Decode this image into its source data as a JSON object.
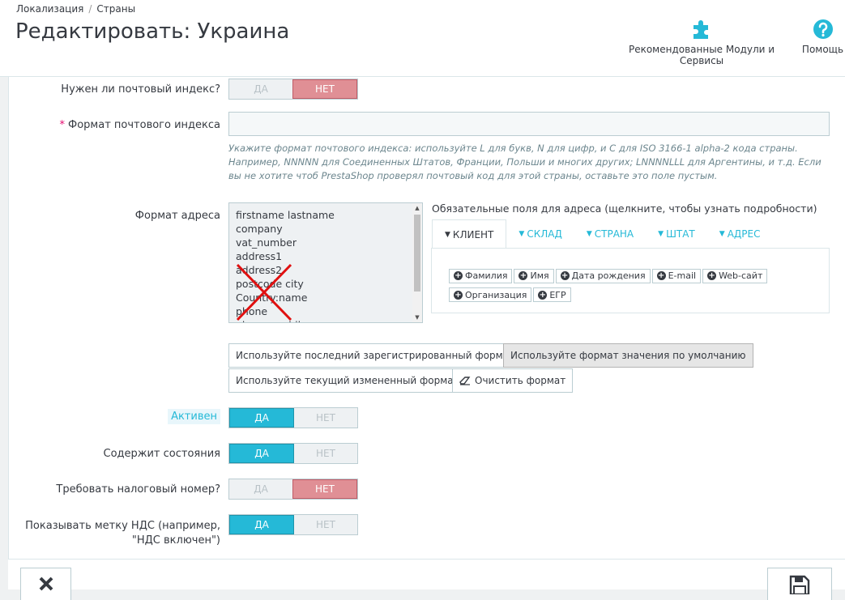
{
  "breadcrumb": {
    "items": [
      "Локализация",
      "Страны"
    ],
    "separator": "/"
  },
  "page": {
    "title": "Редактировать: Украина"
  },
  "toolbar": {
    "modules_label": "Рекомендованные Модули и Сервисы",
    "help_label": "Помощь"
  },
  "colors": {
    "accent": "#25b9d7",
    "danger": "#e08f95",
    "required": "#e50b70"
  },
  "form": {
    "need_zip": {
      "label": "Нужен ли почтовый индекс?",
      "yes": "ДА",
      "no": "НЕТ",
      "value": "no"
    },
    "zip_format": {
      "label": "Формат почтового индекса",
      "value": "",
      "help": "Укажите формат почтового индекса: используйте L для букв, N для цифр, и C для ISO 3166-1 alpha-2 кода страны. Например, NNNNN для Соединенных Штатов, Франции, Польши и многих других; LNNNNLLL для Аргентины, и т.д. Если вы не хотите чтоб PrestaShop проверял почтовый код для этой страны, оставьте это поле пустым."
    },
    "address_format": {
      "label": "Формат адреса",
      "lines": [
        "firstname lastname",
        "company",
        "vat_number",
        "address1",
        "address2",
        "postcode city",
        "Country:name",
        "phone",
        "phone_mobile"
      ]
    },
    "required_fields": {
      "title": "Обязательные поля для адреса (щелкните, чтобы узнать подробности)",
      "tabs": [
        "КЛИЕНТ",
        "СКЛАД",
        "СТРАНА",
        "ШТАТ",
        "АДРЕС"
      ],
      "chips": [
        "Фамилия",
        "Имя",
        "Дата рождения",
        "E-mail",
        "Web-сайт",
        "Организация",
        "ЕГР"
      ]
    },
    "format_buttons": {
      "last_saved": "Используйте последний зарегистрированный формат",
      "default": "Используйте формат значения по умолчанию",
      "current": "Используйте текущий измененный формат",
      "clear": "Очистить формат"
    },
    "active": {
      "label": "Активен",
      "yes": "ДА",
      "no": "НЕТ",
      "value": "yes"
    },
    "contains_states": {
      "label": "Содержит состояния",
      "yes": "ДА",
      "no": "НЕТ",
      "value": "yes"
    },
    "need_tax_id": {
      "label": "Требовать налоговый номер?",
      "yes": "ДА",
      "no": "НЕТ",
      "value": "no"
    },
    "display_tax": {
      "label_line1": "Показывать метку НДС (например,",
      "label_line2": "\"НДС включен\")",
      "yes": "ДА",
      "no": "НЕТ",
      "value": "yes"
    }
  },
  "icons": {
    "modules": "puzzle-icon",
    "help": "question-circle-icon",
    "cancel": "close-icon",
    "save": "floppy-disk-icon",
    "eraser": "eraser-icon",
    "plus": "plus-circle-icon",
    "caret": "caret-down-icon"
  }
}
